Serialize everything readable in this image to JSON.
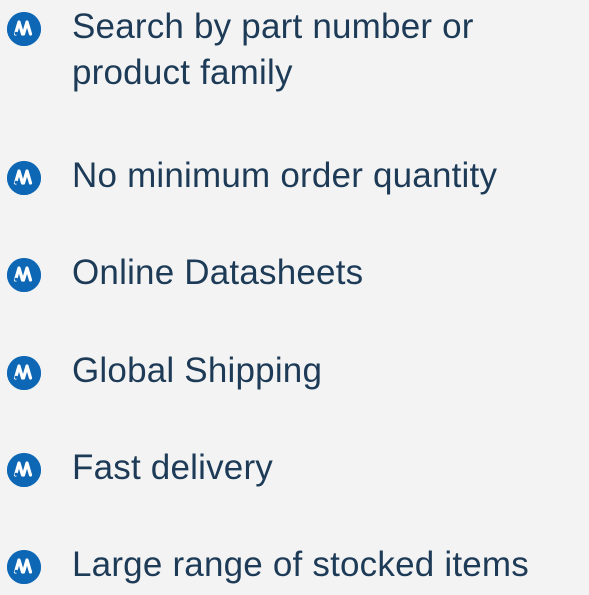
{
  "features": {
    "items": [
      {
        "label": "Search by part number or product family",
        "icon": "murata-logo-icon"
      },
      {
        "label": "No minimum order quantity",
        "icon": "murata-logo-icon"
      },
      {
        "label": "Online Datasheets",
        "icon": "murata-logo-icon"
      },
      {
        "label": "Global Shipping",
        "icon": "murata-logo-icon"
      },
      {
        "label": "Fast delivery",
        "icon": "murata-logo-icon"
      },
      {
        "label": "Large range of stocked items",
        "icon": "murata-logo-icon"
      }
    ]
  },
  "colors": {
    "background": "#f3f3f3",
    "icon": "#0d67b5",
    "text": "#1d3b57"
  }
}
